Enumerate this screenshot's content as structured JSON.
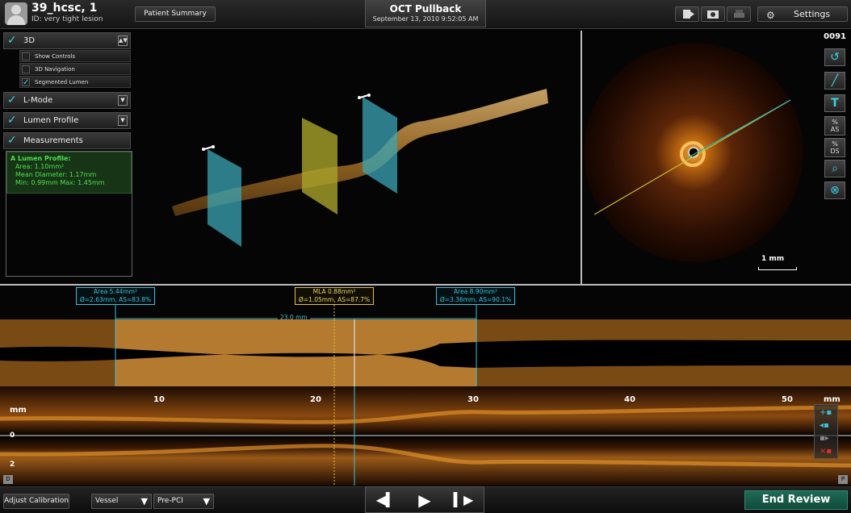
{
  "patient": {
    "name": "39_hcsc, 1",
    "id_line": "ID: very tight lesion"
  },
  "header": {
    "patient_summary_label": "Patient Summary",
    "title": "OCT Pullback",
    "datetime": "September 13, 2010 9:52:05 AM",
    "settings_label": "Settings",
    "icons": [
      "export-icon",
      "camera-icon",
      "print-icon",
      "gear-icon"
    ]
  },
  "left_panel": {
    "controls": [
      {
        "label": "3D",
        "checked": true
      },
      {
        "label": "L-Mode",
        "checked": true
      },
      {
        "label": "Lumen Profile",
        "checked": true
      },
      {
        "label": "Measurements",
        "checked": true
      }
    ],
    "sub_options": [
      {
        "label": "Show Controls",
        "checked": false
      },
      {
        "label": "3D Navigation",
        "checked": false
      },
      {
        "label": "Segmented Lumen",
        "checked": true
      }
    ],
    "lumen_profile": {
      "title": "A Lumen Profile:",
      "area": "Area: 1.10mm²",
      "mean_diameter": "Mean Diameter: 1.17mm",
      "min_max": "Min: 0.99mm   Max: 1.45mm"
    }
  },
  "oct_view": {
    "frame_number": "0091",
    "scale_label": "1 mm",
    "tools": [
      "lasso-icon",
      "line-icon",
      "text-icon",
      "percent-as-icon",
      "percent-ds-icon",
      "zoom-icon",
      "reset-icon"
    ],
    "tool_labels": {
      "text": "T",
      "as": "%\nAS",
      "ds": "%\nDS"
    }
  },
  "annotations": {
    "left": {
      "line1": "Area 5.44mm²",
      "line2": "Ø=2.63mm, AS=83.8%"
    },
    "mla": {
      "line1": "MLA 0.88mm²",
      "line2": "Ø=1.05mm, AS=87.7%"
    },
    "right": {
      "line1": "Area 8.90mm²",
      "line2": "Ø=3.36mm, AS=90.1%"
    },
    "distance": "23.0 mm"
  },
  "lmode": {
    "axis_ticks": [
      "10",
      "20",
      "30",
      "40",
      "50"
    ],
    "axis_unit": "mm",
    "depth_unit": "mm",
    "depth_ticks": [
      "0",
      "2"
    ],
    "end_markers": [
      "D",
      "P"
    ]
  },
  "bottom": {
    "adjust_calibration": "Adjust Calibration",
    "vessel_select": "Vessel",
    "phase_select": "Pre-PCI",
    "end_review": "End Review"
  },
  "colors": {
    "accent_cyan": "#3bc0d8",
    "mla_yellow": "#e0c040",
    "vessel_orange": "#b07a30",
    "end_review_green": "#1f6a55"
  }
}
